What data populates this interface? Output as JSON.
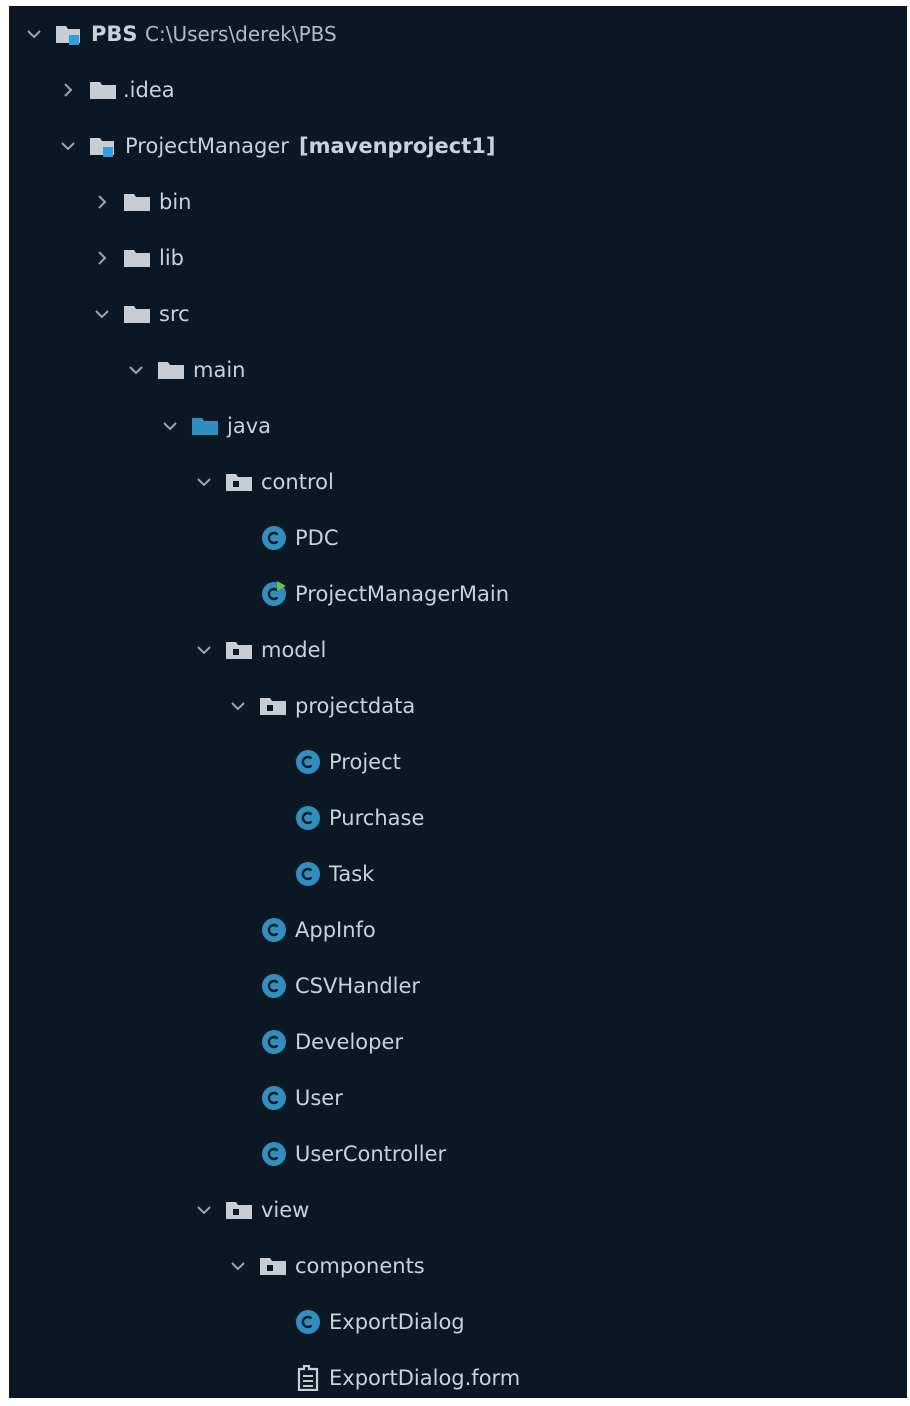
{
  "tree": {
    "root": {
      "name": "PBS",
      "path": "C:\\Users\\derek\\PBS"
    },
    "idea": ".idea",
    "project": {
      "name": "ProjectManager",
      "module": "[mavenproject1]"
    },
    "bin": "bin",
    "lib": "lib",
    "src": "src",
    "main": "main",
    "java": "java",
    "control": "control",
    "pdc": "PDC",
    "projectManagerMain": "ProjectManagerMain",
    "model": "model",
    "projectdata": "projectdata",
    "project_class": "Project",
    "purchase": "Purchase",
    "task": "Task",
    "appInfo": "AppInfo",
    "csvHandler": "CSVHandler",
    "developer": "Developer",
    "user": "User",
    "userController": "UserController",
    "view": "view",
    "components": "components",
    "exportDialog": "ExportDialog",
    "exportDialogForm": "ExportDialog.form"
  },
  "colors": {
    "background": "#0b1824",
    "folder": "#c7cdd3",
    "source_folder": "#2f8fbf",
    "class_icon": "#2f8fbf",
    "module_marker": "#2f9fe0",
    "run_marker": "#6ac24b"
  }
}
